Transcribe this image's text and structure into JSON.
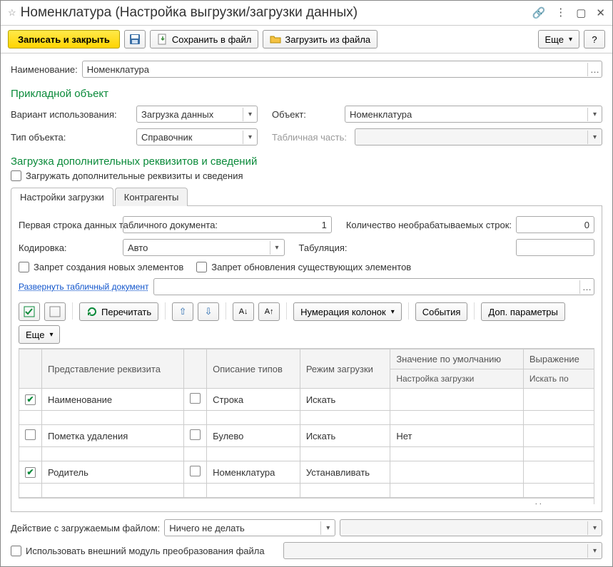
{
  "title": "Номенклатура (Настройка выгрузки/загрузки данных)",
  "toolbar": {
    "save_close": "Записать и закрыть",
    "save_to_file": "Сохранить в файл",
    "load_from_file": "Загрузить из файла",
    "more": "Еще",
    "help": "?"
  },
  "form": {
    "name_label": "Наименование:",
    "name_value": "Номенклатура"
  },
  "applied_object": {
    "title": "Прикладной объект",
    "variant_label": "Вариант использования:",
    "variant_value": "Загрузка данных",
    "object_label": "Объект:",
    "object_value": "Номенклатура",
    "type_label": "Тип объекта:",
    "type_value": "Справочник",
    "tabpart_label": "Табличная часть:",
    "tabpart_value": ""
  },
  "extra": {
    "title": "Загрузка дополнительных реквизитов и сведений",
    "checkbox_label": "Загружать дополнительные реквизиты и сведения"
  },
  "tabs": {
    "t1": "Настройки загрузки",
    "t2": "Контрагенты"
  },
  "settings": {
    "first_row_label": "Первая строка данных табличного документа:",
    "first_row_value": "1",
    "unprocessed_label": "Количество необрабатываемых строк:",
    "unprocessed_value": "0",
    "encoding_label": "Кодировка:",
    "encoding_value": "Авто",
    "tab_label": "Табуляция:",
    "tab_value": "",
    "forbid_create": "Запрет создания новых элементов",
    "forbid_update": "Запрет обновления существующих элементов",
    "expand_link": "Развернуть табличный документ"
  },
  "grid_tb": {
    "reread": "Перечитать",
    "numbering": "Нумерация колонок",
    "events": "События",
    "extra_params": "Доп. параметры",
    "more": "Еще"
  },
  "grid": {
    "h_repr": "Представление реквизита",
    "h_type": "Описание типов",
    "h_mode": "Режим загрузки",
    "h_default": "Значение по умолчанию",
    "h_expr": "Выражение",
    "h_setting": "Настройка загрузки",
    "h_search": "Искать по",
    "rows": [
      {
        "chk1": true,
        "name": "Наименование",
        "chk2": false,
        "type": "Строка",
        "mode": "Искать",
        "default": "",
        "expr": ""
      },
      {
        "chk1": false,
        "name": "Пометка удаления",
        "chk2": false,
        "type": "Булево",
        "mode": "Искать",
        "default": "Нет",
        "expr": ""
      },
      {
        "chk1": true,
        "name": "Родитель",
        "chk2": false,
        "type": "Номенклатура",
        "mode": "Устанавливать",
        "default": "",
        "expr": ""
      }
    ],
    "extra_cell": "Наименов…"
  },
  "footer": {
    "action_label": "Действие с загружаемым файлом:",
    "action_value": "Ничего не делать",
    "use_module": "Использовать внешний модуль преобразования файла"
  }
}
